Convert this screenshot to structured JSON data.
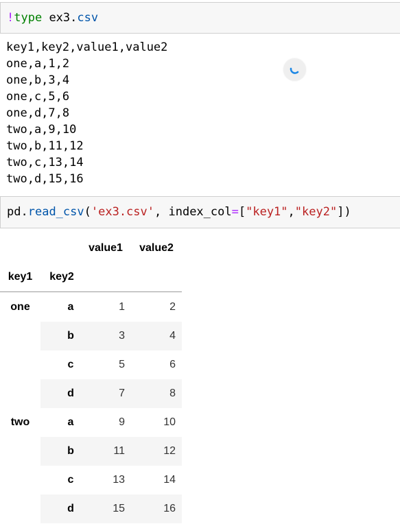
{
  "cells": {
    "cell1": {
      "magic": "!",
      "cmd": "type",
      "arg_prefix": " ex3.",
      "arg_ext": "csv"
    },
    "output1": [
      "key1,key2,value1,value2",
      "one,a,1,2",
      "one,b,3,4",
      "one,c,5,6",
      "one,d,7,8",
      "two,a,9,10",
      "two,b,11,12",
      "two,c,13,14",
      "two,d,15,16"
    ],
    "cell2": {
      "obj": "pd",
      "dot": ".",
      "func": "read_csv",
      "open": "(",
      "arg1": "'ex3.csv'",
      "sep": ", ",
      "kwarg": "index_col",
      "eq": "=",
      "lb": "[",
      "s1": "\"key1\"",
      "comma": ",",
      "s2": "\"key2\"",
      "close": "])"
    }
  },
  "dataframe": {
    "columns": [
      "value1",
      "value2"
    ],
    "index_names": [
      "key1",
      "key2"
    ],
    "rows": [
      {
        "key1": "one",
        "key2": "a",
        "value1": "1",
        "value2": "2"
      },
      {
        "key1": "",
        "key2": "b",
        "value1": "3",
        "value2": "4"
      },
      {
        "key1": "",
        "key2": "c",
        "value1": "5",
        "value2": "6"
      },
      {
        "key1": "",
        "key2": "d",
        "value1": "7",
        "value2": "8"
      },
      {
        "key1": "two",
        "key2": "a",
        "value1": "9",
        "value2": "10"
      },
      {
        "key1": "",
        "key2": "b",
        "value1": "11",
        "value2": "12"
      },
      {
        "key1": "",
        "key2": "c",
        "value1": "13",
        "value2": "14"
      },
      {
        "key1": "",
        "key2": "d",
        "value1": "15",
        "value2": "16"
      }
    ]
  },
  "colors": {
    "cell_background": "#f7f7f7",
    "row_stripe": "#f5f5f5",
    "string": "#ba2121",
    "keyword": "#008000",
    "magic": "#aa22ff",
    "spinner": "#1e88e5"
  },
  "icons": {
    "spinner": "loading-spinner-icon"
  }
}
